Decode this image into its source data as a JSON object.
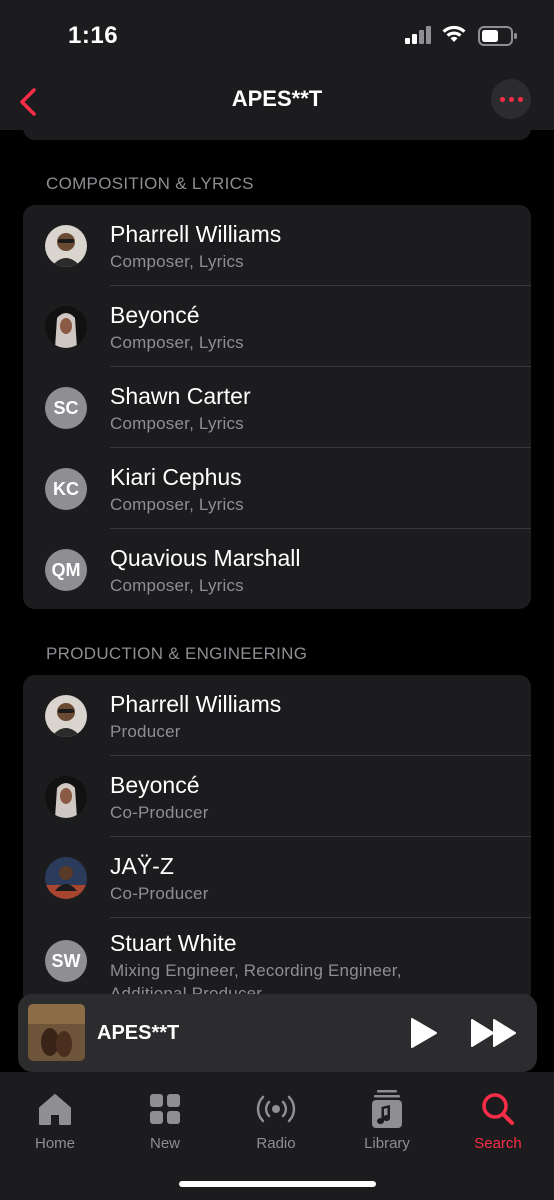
{
  "status_bar": {
    "time": "1:16"
  },
  "nav": {
    "title": "APES**T"
  },
  "sections": [
    {
      "title": "COMPOSITION & LYRICS",
      "rows": [
        {
          "name": "Pharrell Williams",
          "role": "Composer, Lyrics",
          "avatar": "photo",
          "avatar_icon": "pharrell-photo"
        },
        {
          "name": "Beyoncé",
          "role": "Composer, Lyrics",
          "avatar": "photo",
          "avatar_icon": "beyonce-photo"
        },
        {
          "name": "Shawn Carter",
          "role": "Composer, Lyrics",
          "avatar": "initials",
          "initials": "SC"
        },
        {
          "name": "Kiari Cephus",
          "role": "Composer, Lyrics",
          "avatar": "initials",
          "initials": "KC"
        },
        {
          "name": "Quavious Marshall",
          "role": "Composer, Lyrics",
          "avatar": "initials",
          "initials": "QM"
        }
      ]
    },
    {
      "title": "PRODUCTION & ENGINEERING",
      "rows": [
        {
          "name": "Pharrell Williams",
          "role": "Producer",
          "avatar": "photo",
          "avatar_icon": "pharrell-photo"
        },
        {
          "name": "Beyoncé",
          "role": "Co-Producer",
          "avatar": "photo",
          "avatar_icon": "beyonce-photo"
        },
        {
          "name": "JAŸ-Z",
          "role": "Co-Producer",
          "avatar": "photo",
          "avatar_icon": "jayz-photo"
        },
        {
          "name": "Stuart White",
          "role": "Mixing Engineer, Recording Engineer,",
          "role_cont": "Additional Producer",
          "avatar": "initials",
          "initials": "SW"
        }
      ]
    }
  ],
  "mini_player": {
    "title": "APES**T",
    "play_icon": "play-icon",
    "forward_icon": "fast-forward-icon"
  },
  "tabs": [
    {
      "label": "Home",
      "icon": "home-icon",
      "active": false
    },
    {
      "label": "New",
      "icon": "grid-icon",
      "active": false
    },
    {
      "label": "Radio",
      "icon": "radio-icon",
      "active": false
    },
    {
      "label": "Library",
      "icon": "library-icon",
      "active": false
    },
    {
      "label": "Search",
      "icon": "search-icon",
      "active": true
    }
  ],
  "colors": {
    "accent": "#fa2d48",
    "background": "#000000",
    "card": "#1c1c1e",
    "secondary_text": "#8e8e93"
  }
}
